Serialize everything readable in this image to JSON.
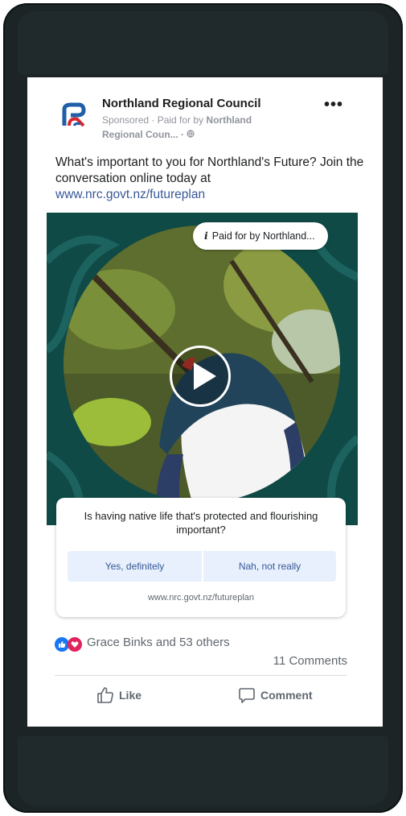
{
  "post": {
    "page_name": "Northland Regional Council",
    "sponsored_prefix": "Sponsored · Paid for by",
    "sponsored_payer": "Northland",
    "sponsored_suffix": "Regional Coun... ·",
    "globe_icon": "globe-icon",
    "more_icon": "•••",
    "text_line": "What's important to you for Northland's Future? Join the conversation online today at",
    "link": "www.nrc.govt.nz/futureplan"
  },
  "media": {
    "paid_label": "Paid for by Northland...",
    "info_icon": "i",
    "play_icon": "play-icon"
  },
  "poll": {
    "question": "Is having native life that's protected and flourishing important?",
    "option_yes": "Yes, definitely",
    "option_no": "Nah, not really",
    "url": "www.nrc.govt.nz/futureplan"
  },
  "engagement": {
    "reactions_text": "Grace Binks and 53 others",
    "comments_text": "11 Comments",
    "like_label": "Like",
    "comment_label": "Comment"
  },
  "colors": {
    "link": "#385898",
    "poll_option_bg": "#e7f0fc",
    "media_bg": "#0f4a47",
    "like_blue": "#1877f2",
    "love_red": "#e0245e"
  }
}
